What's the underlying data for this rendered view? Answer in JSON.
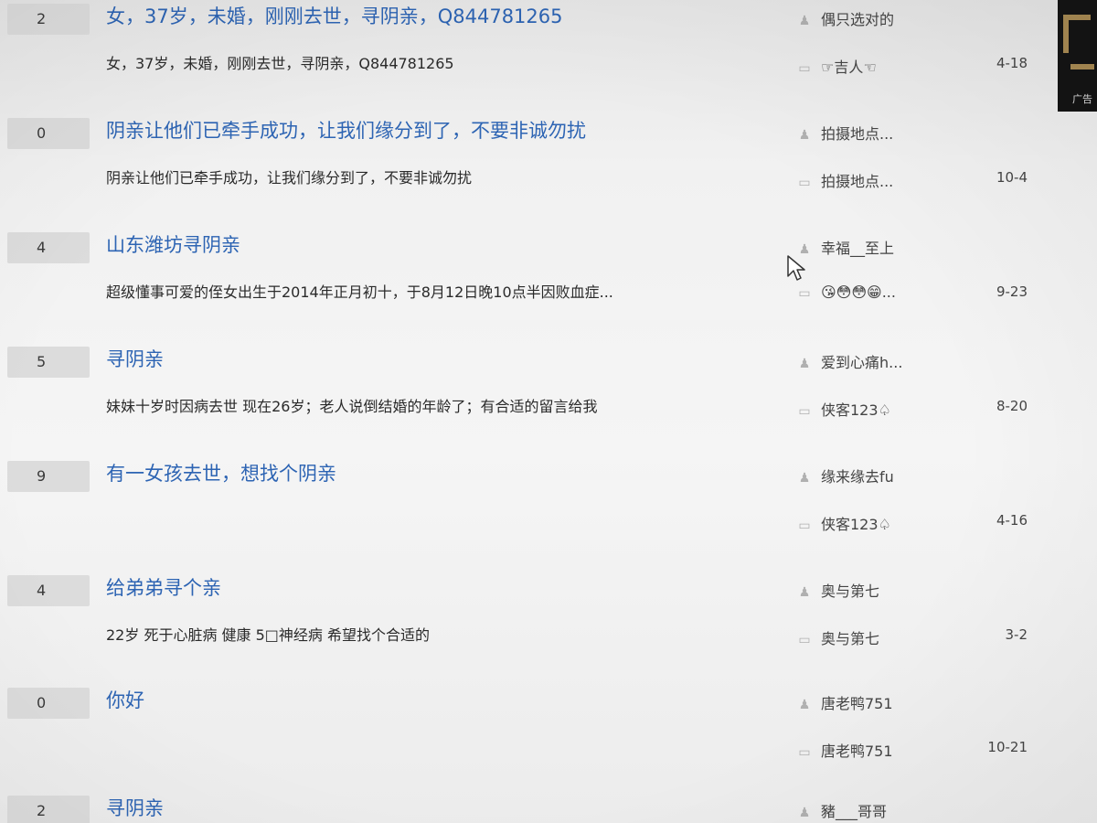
{
  "icons": {
    "author": "user-icon",
    "last_reply": "comment-icon"
  },
  "colors": {
    "title": "#2d64b3",
    "reply_count_bg": "#dcdcdc",
    "ad_bg": "#141414",
    "ad_accent": "#a88a53"
  },
  "ad": {
    "label": "广告"
  },
  "threads": [
    {
      "reply_count": "2",
      "title": "女，37岁，未婚，刚刚去世，寻阴亲，Q844781265",
      "preview": "女，37岁，未婚，刚刚去世，寻阴亲，Q844781265",
      "author": "偶只选对的",
      "last_reply_user": "☞吉人☜",
      "last_reply_time": "4-18"
    },
    {
      "reply_count": "0",
      "title": "阴亲让他们已牵手成功，让我们缘分到了，不要非诚勿扰",
      "preview": "阴亲让他们已牵手成功，让我们缘分到了，不要非诚勿扰",
      "author": "拍摄地点...",
      "last_reply_user": "拍摄地点...",
      "last_reply_time": "10-4"
    },
    {
      "reply_count": "4",
      "title": "山东潍坊寻阴亲",
      "preview": "超级懂事可爱的侄女出生于2014年正月初十，于8月12日晚10点半因败血症...",
      "author": "幸福__至上",
      "last_reply_user": "😘😳😳😁...",
      "last_reply_time": "9-23"
    },
    {
      "reply_count": "5",
      "title": "寻阴亲",
      "preview": "妹妹十岁时因病去世 现在26岁；老人说倒结婚的年龄了；有合适的留言给我",
      "author": "爱到心痛h...",
      "last_reply_user": "侠客123♤",
      "last_reply_time": "8-20"
    },
    {
      "reply_count": "9",
      "title": "有一女孩去世，想找个阴亲",
      "preview": "",
      "author": "缘来缘去fu",
      "last_reply_user": "侠客123♤",
      "last_reply_time": "4-16"
    },
    {
      "reply_count": "4",
      "title": "给弟弟寻个亲",
      "preview": "22岁 死于心脏病 健康 5□神经病 希望找个合适的",
      "author": "奥与第七",
      "last_reply_user": "奥与第七",
      "last_reply_time": "3-2"
    },
    {
      "reply_count": "0",
      "title": "你好",
      "preview": "",
      "author": "唐老鸭751",
      "last_reply_user": "唐老鸭751",
      "last_reply_time": "10-21"
    },
    {
      "reply_count": "2",
      "title": "寻阴亲",
      "preview": "",
      "author": "豬___哥哥",
      "last_reply_user": "",
      "last_reply_time": ""
    }
  ]
}
